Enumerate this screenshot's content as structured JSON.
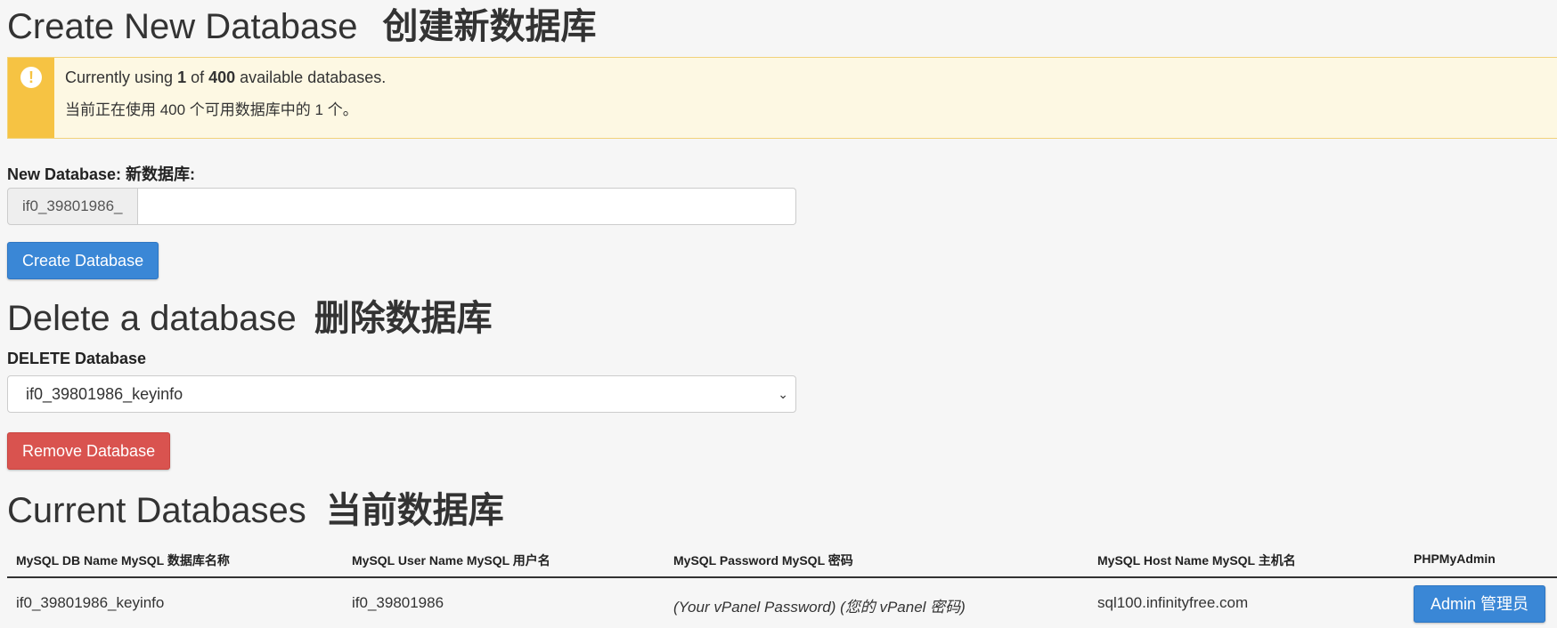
{
  "create": {
    "title": "Create New Database",
    "title_cn": "创建新数据库",
    "alert": {
      "line1_prefix": "Currently using ",
      "line1_used": "1",
      "line1_of": " of ",
      "line1_total": "400",
      "line1_suffix": " available databases.",
      "line2": "当前正在使用 400 个可用数据库中的 1 个。"
    },
    "field_label": "New Database:  新数据库:",
    "prefix": "if0_39801986_",
    "input_value": "",
    "button_label": "Create Database"
  },
  "delete": {
    "title": "Delete a database",
    "title_cn": "删除数据库",
    "field_label": "DELETE Database",
    "selected": "if0_39801986_keyinfo",
    "button_label": "Remove Database"
  },
  "current": {
    "title": "Current Databases",
    "title_cn": "当前数据库",
    "columns": [
      "MySQL DB Name  MySQL 数据库名称",
      "MySQL User Name   MySQL 用户名",
      "MySQL Password   MySQL 密码",
      "MySQL Host Name  MySQL 主机名",
      "PHPMyAdmin"
    ],
    "rows": [
      {
        "db_name": "if0_39801986_keyinfo",
        "user_name": "if0_39801986",
        "password": "(Your vPanel Password)  (您的 vPanel 密码)",
        "host": "sql100.infinityfree.com",
        "admin_label": "Admin  管理员"
      }
    ]
  },
  "colors": {
    "primary": "#3a87d6",
    "danger": "#d9534f",
    "warning": "#f6c343",
    "warning_bg": "#fdf8e3"
  },
  "icons": {
    "alert": "exclamation-circle-icon",
    "select": "chevron-down-icon"
  }
}
